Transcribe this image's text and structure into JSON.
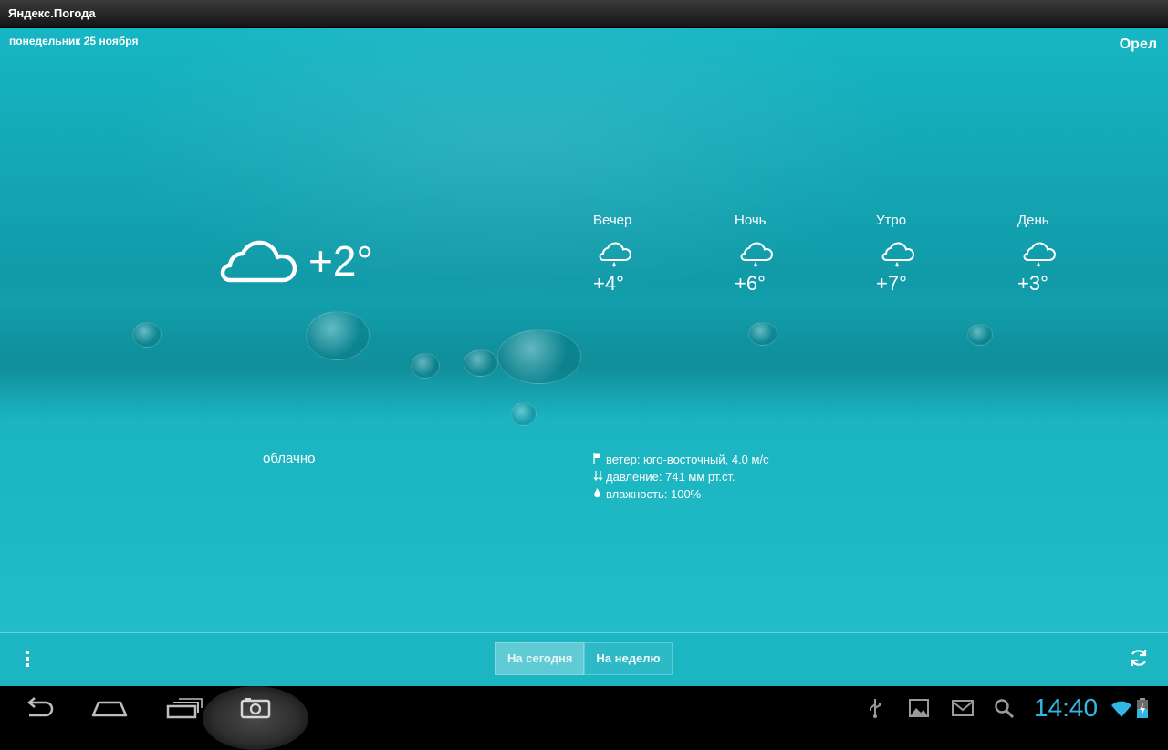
{
  "app": {
    "title": "Яндекс.Погода"
  },
  "header": {
    "date": "понедельник 25 ноября",
    "city": "Орел"
  },
  "current": {
    "icon": "cloud-icon",
    "temperature": "+2°",
    "condition": "облачно"
  },
  "forecast": [
    {
      "label": "Вечер",
      "icon": "cloud-drizzle-icon",
      "temperature": "+4°"
    },
    {
      "label": "Ночь",
      "icon": "cloud-drizzle-icon",
      "temperature": "+6°"
    },
    {
      "label": "Утро",
      "icon": "cloud-drizzle-icon",
      "temperature": "+7°"
    },
    {
      "label": "День",
      "icon": "cloud-drizzle-icon",
      "temperature": "+3°"
    }
  ],
  "details": {
    "wind": "ветер: юго-восточный, 4.0 м/с",
    "pressure": "давление: 741 мм рт.ст.",
    "humidity": "влажность: 100%"
  },
  "tabs": {
    "today": "На сегодня",
    "week": "На неделю",
    "active": "today"
  },
  "system": {
    "clock": "14:40",
    "accent": "#33b5e5"
  }
}
